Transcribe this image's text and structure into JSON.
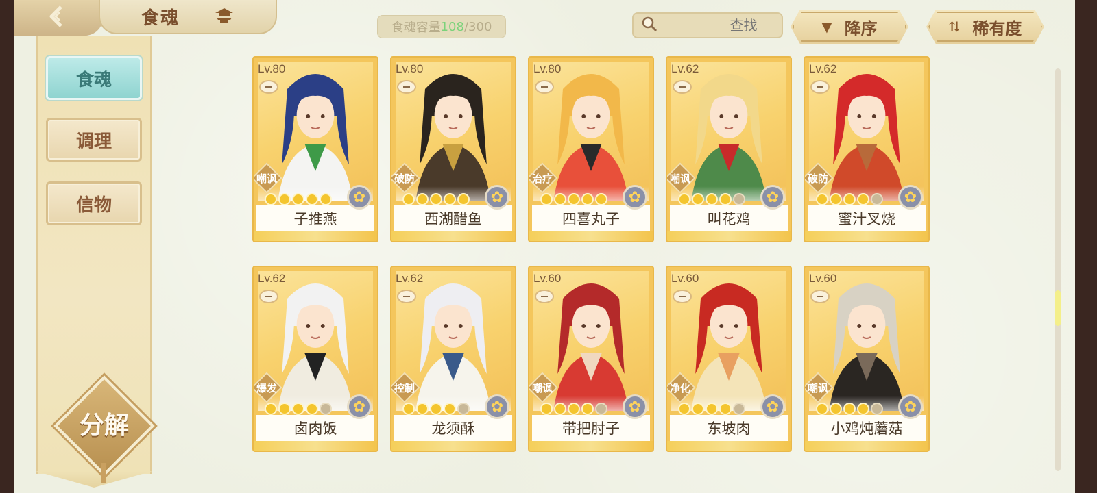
{
  "header": {
    "title": "食魂",
    "capacity_label": "食魂容量 ",
    "capacity_current": "108",
    "capacity_sep_max": "/300",
    "search_placeholder": "查找",
    "search_clear": "✕",
    "sort_label": "降序",
    "sort_icon": "▼",
    "rarity_label": "稀有度",
    "rarity_icon": "⇅"
  },
  "sidebar": {
    "tabs": [
      {
        "label": "食魂",
        "active": true
      },
      {
        "label": "调理",
        "active": false
      },
      {
        "label": "信物",
        "active": false
      }
    ],
    "decompose_label": "分解"
  },
  "cards": [
    {
      "name": "子推燕",
      "level": "Lv.80",
      "role": "嘲讽",
      "stars": 5,
      "hair": "#2b3f86",
      "cloth": "#f4f4f2",
      "accent": "#3e9a48"
    },
    {
      "name": "西湖醋鱼",
      "level": "Lv.80",
      "role": "破防",
      "stars": 5,
      "hair": "#2a241e",
      "cloth": "#4a3a2a",
      "accent": "#c8a040"
    },
    {
      "name": "四喜丸子",
      "level": "Lv.80",
      "role": "治疗",
      "stars": 5,
      "hair": "#f2b84a",
      "cloth": "#e8503a",
      "accent": "#2a2a2a"
    },
    {
      "name": "叫花鸡",
      "level": "Lv.62",
      "role": "嘲讽",
      "stars": 4,
      "hair": "#f2d88a",
      "cloth": "#4e8a4a",
      "accent": "#c82a2a"
    },
    {
      "name": "蜜汁叉烧",
      "level": "Lv.62",
      "role": "破防",
      "stars": 4,
      "hair": "#d42a2a",
      "cloth": "#d04a2a",
      "accent": "#b86a3a"
    },
    {
      "name": "卤肉饭",
      "level": "Lv.62",
      "role": "爆发",
      "stars": 4,
      "hair": "#f2f2f2",
      "cloth": "#f0ece0",
      "accent": "#222222"
    },
    {
      "name": "龙须酥",
      "level": "Lv.62",
      "role": "控制",
      "stars": 4,
      "hair": "#eeeef2",
      "cloth": "#f6f4ec",
      "accent": "#3a5a8a"
    },
    {
      "name": "带把肘子",
      "level": "Lv.60",
      "role": "嘲讽",
      "stars": 4,
      "hair": "#b42a2a",
      "cloth": "#d83a32",
      "accent": "#f0d8c0"
    },
    {
      "name": "东坡肉",
      "level": "Lv.60",
      "role": "净化",
      "stars": 4,
      "hair": "#c82a22",
      "cloth": "#f4e4b8",
      "accent": "#e8a060"
    },
    {
      "name": "小鸡炖蘑菇",
      "level": "Lv.60",
      "role": "嘲讽",
      "stars": 4,
      "hair": "#d8d2c4",
      "cloth": "#2a2622",
      "accent": "#7a6a5a"
    }
  ],
  "colors": {
    "accent_gold": "#f4c65c",
    "tab_active": "#8fd4d0",
    "capacity_current": "#7bd27b"
  }
}
